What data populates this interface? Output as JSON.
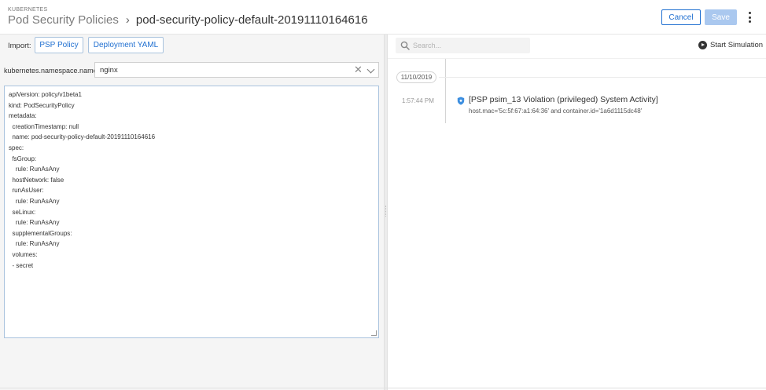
{
  "header": {
    "overline": "KUBERNETES",
    "breadcrumb_parent": "Pod Security Policies",
    "breadcrumb_separator": "›",
    "breadcrumb_current": "pod-security-policy-default-20191110164616",
    "cancel_label": "Cancel",
    "save_label": "Save",
    "more_icon": "more-vertical-icon"
  },
  "import": {
    "label": "Import:",
    "psp_button": "PSP Policy",
    "yaml_button": "Deployment YAML"
  },
  "namespace": {
    "label": "kubernetes.namespace.name",
    "value": "nginx",
    "clear_glyph": "✕"
  },
  "yaml": {
    "lines": [
      "apiVersion: policy/v1beta1",
      "kind: PodSecurityPolicy",
      "metadata:",
      "  creationTimestamp: null",
      "  name: pod-security-policy-default-20191110164616",
      "spec:",
      "  fsGroup:",
      "    rule: RunAsAny",
      "  hostNetwork: false",
      "  runAsUser:",
      "    rule: RunAsAny",
      "  seLinux:",
      "    rule: RunAsAny",
      "  supplementalGroups:",
      "    rule: RunAsAny",
      "  volumes:",
      "  - secret"
    ]
  },
  "search": {
    "placeholder": "Search...",
    "icon": "search-icon"
  },
  "simulation": {
    "label": "Start Simulation",
    "icon": "play-circle-icon"
  },
  "timeline": {
    "date": "11/10/2019",
    "events": [
      {
        "time": "1:57:44 PM",
        "title": "[PSP psim_13 Violation (privileged) System Activity]",
        "detail": "host.mac='5c:5f:67:a1:64:36' and container.id='1a6d1115dc48'",
        "icon": "shield-icon"
      }
    ]
  },
  "colors": {
    "primary": "#1f6fd0",
    "save_disabled": "#aac8ef",
    "event_icon": "#3d8fe0"
  }
}
